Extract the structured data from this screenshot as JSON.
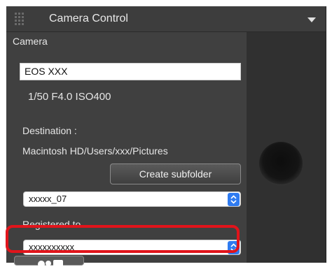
{
  "titlebar": {
    "title": "Camera Control"
  },
  "camera": {
    "section_label": "Camera",
    "model": "EOS XXX",
    "exposure_info": "1/50  F4.0  ISO400"
  },
  "destination": {
    "section_label": "Destination :",
    "path": "Macintosh HD/Users/xxx/Pictures",
    "create_subfolder_label": "Create subfolder",
    "folder_select_value": "xxxxx_07"
  },
  "registered": {
    "section_label": "Registered to",
    "select_value": "xxxxxxxxxx"
  },
  "colors": {
    "highlight": "#e1141b",
    "stepper": "#2f7bf0",
    "panel": "#404040"
  }
}
